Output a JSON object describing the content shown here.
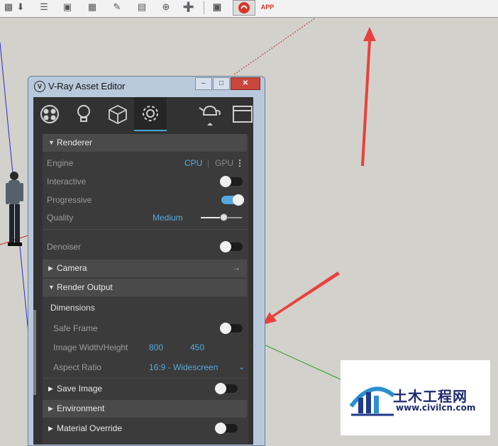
{
  "toolbar": {
    "icons": [
      "paint-bucket-icon",
      "push-pull-icon",
      "align-icon",
      "box-icon",
      "layers-icon",
      "edit-icon",
      "books-icon",
      "component-icon",
      "plugin-icon",
      "vray-book-icon",
      "render-icon"
    ],
    "app_badge": "APP"
  },
  "window": {
    "title": "V-Ray Asset Editor",
    "minimize": "–",
    "maximize": "□",
    "close": "✕"
  },
  "tabs": [
    {
      "name": "materials",
      "icon": "material-sphere-icon"
    },
    {
      "name": "lights",
      "icon": "bulb-icon"
    },
    {
      "name": "geometry",
      "icon": "cube-icon"
    },
    {
      "name": "settings",
      "icon": "gear-icon",
      "active": true
    },
    {
      "name": "render",
      "icon": "teapot-icon"
    },
    {
      "name": "frame-buffer",
      "icon": "frame-buffer-icon"
    }
  ],
  "renderer": {
    "header": "Renderer",
    "engine_label": "Engine",
    "engine_cpu": "CPU",
    "engine_gpu": "GPU",
    "interactive_label": "Interactive",
    "interactive_on": false,
    "progressive_label": "Progressive",
    "progressive_on": true,
    "quality_label": "Quality",
    "quality_value": "Medium",
    "quality_level": 0.55,
    "denoiser_label": "Denoiser",
    "denoiser_on": false
  },
  "camera": {
    "header": "Camera"
  },
  "render_output": {
    "header": "Render Output",
    "dimensions_label": "Dimensions",
    "safe_frame_label": "Safe Frame",
    "safe_frame_on": false,
    "image_wh_label": "Image Width/Height",
    "width": "800",
    "height": "450",
    "aspect_label": "Aspect Ratio",
    "aspect_value": "16:9 - Widescreen"
  },
  "save_image": {
    "header": "Save Image",
    "on": false
  },
  "environment": {
    "header": "Environment"
  },
  "material_override": {
    "header": "Material Override",
    "on": false
  },
  "watermark": {
    "name": "土木工程网",
    "url": "www.civilcn.com"
  },
  "colors": {
    "accent": "#57a8dc",
    "arrow": "#e8413d"
  }
}
